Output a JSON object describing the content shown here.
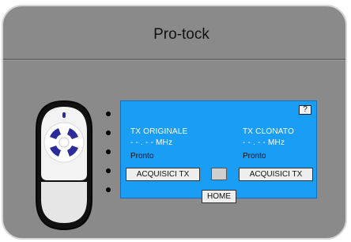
{
  "app": {
    "title": "Pro-tock"
  },
  "screen": {
    "help_label": "?",
    "original": {
      "heading": "TX ORIGINALE",
      "frequency": "- - . - - MHz",
      "status": "Pronto",
      "acquire_label": "ACQUISICI TX"
    },
    "cloned": {
      "heading": "TX CLONATO",
      "frequency": "- - . - - MHz",
      "status": "Pronto",
      "acquire_label": "ACQUISICI TX"
    },
    "home_label": "HOME"
  },
  "colors": {
    "screen_bg": "#1a9df5",
    "device_bg": "#8a8a8a",
    "remote_buttons": "#2a2d9a"
  },
  "remote": {
    "icon": "remote-control-icon",
    "button_count": 4
  },
  "leds": {
    "count": 5
  }
}
